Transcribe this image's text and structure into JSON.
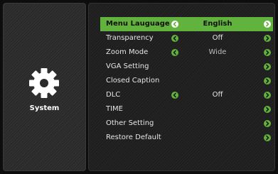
{
  "sidebar": {
    "icon": "gear-icon",
    "label": "System"
  },
  "menu": {
    "items": [
      {
        "label": "Menu Lauguage",
        "value": "English",
        "left_arrow": true,
        "right_arrow": true,
        "selected": true
      },
      {
        "label": "Transparency",
        "value": "Off",
        "left_arrow": true,
        "right_arrow": true,
        "selected": false
      },
      {
        "label": "Zoom Mode",
        "value": "Wide",
        "left_arrow": true,
        "right_arrow": true,
        "selected": false
      },
      {
        "label": "VGA Setting",
        "value": "",
        "left_arrow": false,
        "right_arrow": true,
        "selected": false
      },
      {
        "label": "Closed Caption",
        "value": "",
        "left_arrow": false,
        "right_arrow": true,
        "selected": false
      },
      {
        "label": "DLC",
        "value": "Off",
        "left_arrow": true,
        "right_arrow": true,
        "selected": false
      },
      {
        "label": "TIME",
        "value": "",
        "left_arrow": false,
        "right_arrow": true,
        "selected": false
      },
      {
        "label": "Other Setting",
        "value": "",
        "left_arrow": false,
        "right_arrow": true,
        "selected": false
      },
      {
        "label": "Restore Default",
        "value": "",
        "left_arrow": false,
        "right_arrow": true,
        "selected": false
      }
    ]
  },
  "colors": {
    "accent": "#62b33d",
    "text": "#e6e6e6",
    "background": "#0d0d0d"
  }
}
